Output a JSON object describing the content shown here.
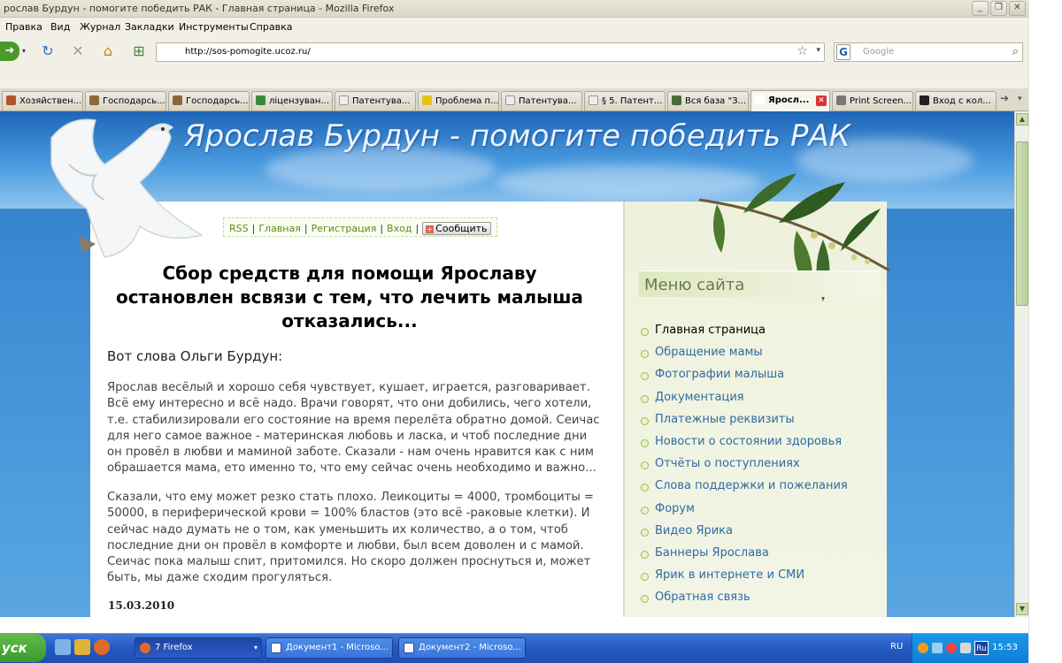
{
  "window": {
    "title": "рослав Бурдун - помогите победить РАК - Главная страница - Mozilla Firefox"
  },
  "menu": [
    "Правка",
    "Вид",
    "Журнал",
    "Закладки",
    "Инструменты",
    "Справка"
  ],
  "nav": {
    "url": "http://sos-pomogite.ucoz.ru/",
    "search_placeholder": "Google",
    "search_engine_letter": "G"
  },
  "tabs": [
    {
      "label": "Хозяйствен...",
      "color": "#b0552a"
    },
    {
      "label": "Господарсь...",
      "color": "#8a6a3a"
    },
    {
      "label": "Господарсь...",
      "color": "#8a6a3a"
    },
    {
      "label": "ліцензуван...",
      "color": "#3a8a3a"
    },
    {
      "label": "Патентува...",
      "color": "#eeeeee"
    },
    {
      "label": "Проблема п...",
      "color": "#e8c21a"
    },
    {
      "label": "Патентува...",
      "color": "#eeeeee"
    },
    {
      "label": "§ 5. Патент...",
      "color": "#eeeeee"
    },
    {
      "label": "Вся база \"З...",
      "color": "#4a6a3a"
    },
    {
      "label": "Яросл...",
      "color": "#ffffff",
      "active": true
    },
    {
      "label": "Print Screen...",
      "color": "#777777"
    },
    {
      "label": "Вход с кол...",
      "color": "#222222"
    }
  ],
  "page": {
    "site_title": "Ярослав Бурдун - помогите победить РАК",
    "top_links": {
      "rss": "RSS",
      "home": "Главная",
      "register": "Регистрация",
      "login": "Вход",
      "report_button": "Сообщить"
    },
    "headline": "Сбор средств для помощи Ярославу остановлен всвязи с тем, что лечить малыша отказались...",
    "lead": "Вот слова Ольги Бурдун:",
    "paragraph1": "Ярослав весёлый и хорошо себя чувствует, кушает, играется, разговаривает. Всё ему интересно и всё надо. Врачи говорят, что они добились, чего хотели, т.е. стабилизировали его состояние на время перелёта обратно домой. Сеичас для него самое важное - материнская любовь и ласка, и чтоб последние дни он провёл в любви и маминой заботе. Сказали - нам очень нравится как с ним обрашается мама, ето именно то, что ему сейчас очень необходимо и важно...",
    "paragraph2": "Сказали, что ему может резко стать плохо. Леикоциты = 4000, тромбоциты = 50000, в периферической крови = 100% бластов (это всё -раковые клетки). И сейчас надо думать не о том, как уменьшить их количество, а о том, чтоб последние дни он провёл в комфорте и любви, был всем доволен и с мамой. Сеичас пока малыш спит, притомился. Но скоро должен проснуться и, может быть, мы даже сходим прогуляться.",
    "date": "15.03.2010",
    "menu_title": "Меню сайта",
    "menu_items": [
      "Главная страница",
      "Обращение мамы",
      "Фотографии малыша",
      "Документация",
      "Платежные реквизиты",
      "Новости о состоянии здоровья",
      "Отчёты о поступлениях",
      "Слова поддержки и пожелания",
      "Форум",
      "Видео Ярика",
      "Баннеры Ярослава",
      "Ярик в интернете и СМИ",
      "Обратная связь"
    ]
  },
  "taskbar": {
    "start": "уск",
    "buttons": [
      "7 Firefox",
      "Документ1 - Microso...",
      "Документ2 - Microso..."
    ],
    "lang": "RU",
    "tray_lang": "Ru",
    "clock": "15:53"
  },
  "colors": {
    "link_green": "#5b8d12",
    "menu_link_blue": "#2f6aa0",
    "sky_blue": "#3f8fd6",
    "taskbar_blue": "#2559c4",
    "start_green": "#3a9a2b"
  }
}
